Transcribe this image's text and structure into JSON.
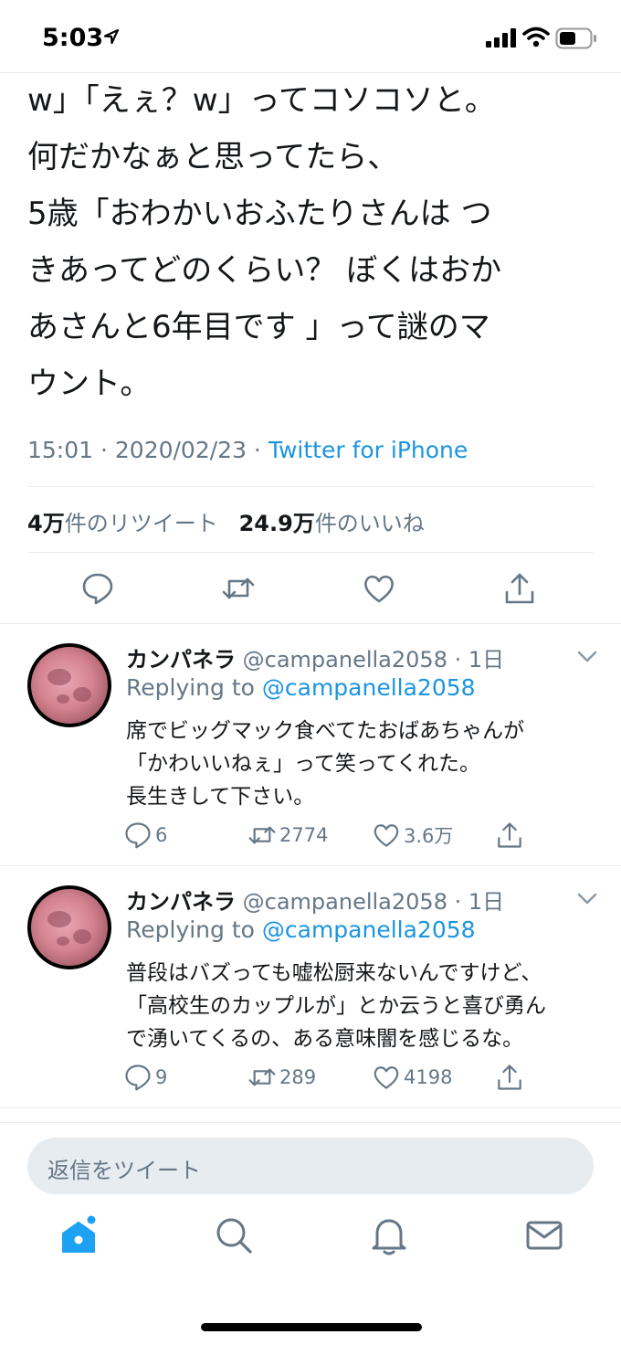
{
  "status_bar": {
    "time": "5:03"
  },
  "tweet": {
    "lines": [
      "w」「えぇ？w」ってコソコソと。",
      "何だかなぁと思ってたら、",
      "5歳「おわかいおふたりさんは つ",
      "きあってどのくらい？ ぼくはおか",
      "あさんと6年目です 」って謎のマ",
      "ウント。"
    ],
    "time": "15:01 · 2020/02/23 · ",
    "source": "Twitter for iPhone",
    "retweets_count": "4万",
    "retweets_label": "件のリツイート",
    "likes_count": "24.9万",
    "likes_label": "件のいいね"
  },
  "replies": [
    {
      "name": "カンパネラ",
      "handle": "@campanella2058 · 1日",
      "replying_prefix": "Replying to ",
      "replying_to": "@campanella2058",
      "text": "席でビッグマック食べてたおばあちゃんが\n「かわいいねぇ」って笑ってくれた。\n長生きして下さい。",
      "reply_count": "6",
      "retweet_count": "2774",
      "like_count": "3.6万"
    },
    {
      "name": "カンパネラ",
      "handle": "@campanella2058 · 1日",
      "replying_prefix": "Replying to ",
      "replying_to": "@campanella2058",
      "text": "普段はバズっても嘘松厨来ないんですけど、\n「高校生のカップルが」とか云うと喜び勇ん\nで湧いてくるの、ある意味闇を感じるな。",
      "reply_count": "9",
      "retweet_count": "289",
      "like_count": "4198"
    }
  ],
  "composer": {
    "placeholder": "返信をツイート"
  },
  "colors": {
    "accent": "#1da1f2",
    "link": "#1b95e0",
    "muted": "#657786",
    "divider": "#e6ecf0"
  },
  "icons": {
    "tabs": [
      "home-icon",
      "search-icon",
      "notifications-icon",
      "messages-icon"
    ],
    "actions": [
      "reply-icon",
      "retweet-icon",
      "like-icon",
      "share-icon"
    ]
  }
}
